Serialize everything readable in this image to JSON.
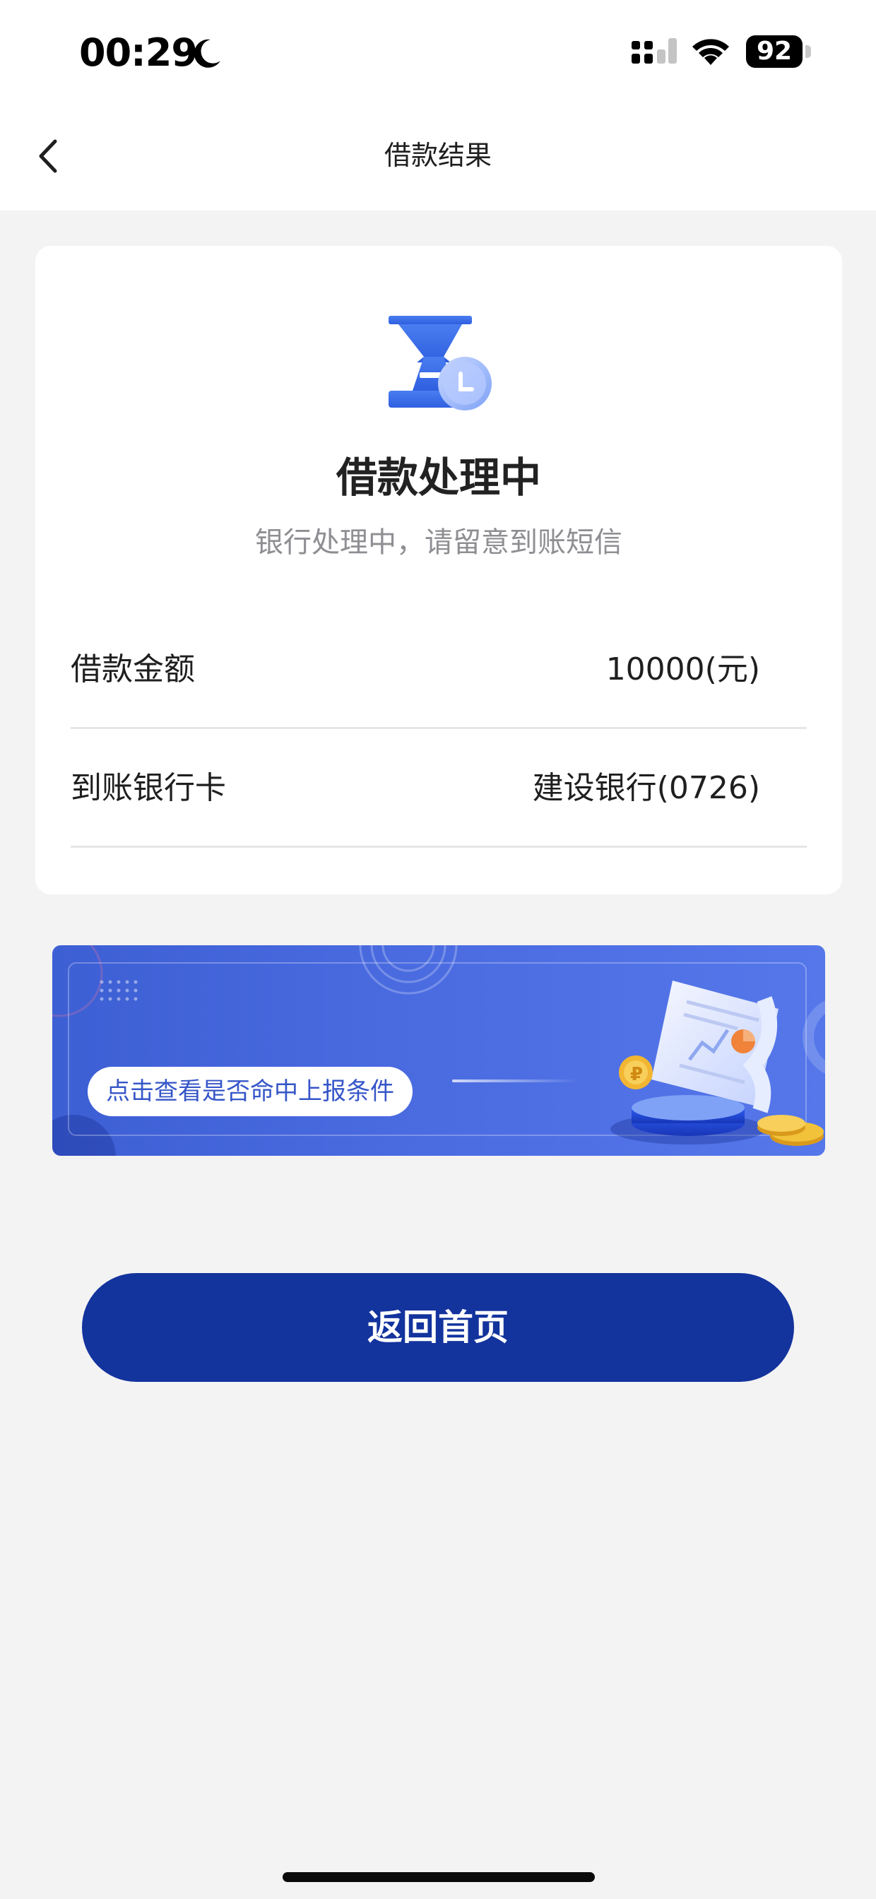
{
  "status_bar": {
    "time": "00:29",
    "battery_level": "92",
    "icons": [
      "moon-icon",
      "cellular-signal-icon",
      "wifi-icon",
      "battery-icon"
    ]
  },
  "nav": {
    "title": "借款结果",
    "back_icon": "chevron-left-icon"
  },
  "result": {
    "icon": "hourglass-clock-icon",
    "title": "借款处理中",
    "subtitle": "银行处理中，请留意到账短信",
    "rows": [
      {
        "label": "借款金额",
        "value": "10000(元)"
      },
      {
        "label": "到账银行卡",
        "value": "建设银行(0726)"
      }
    ]
  },
  "banner": {
    "cta_label": "点击查看是否命中上报条件",
    "illustration": "document-coins-illustration"
  },
  "actions": {
    "home_label": "返回首页"
  },
  "colors": {
    "primary": "#13339d",
    "banner": "#4a6be0",
    "background": "#f3f3f3",
    "subtitle": "#8e8e93"
  }
}
